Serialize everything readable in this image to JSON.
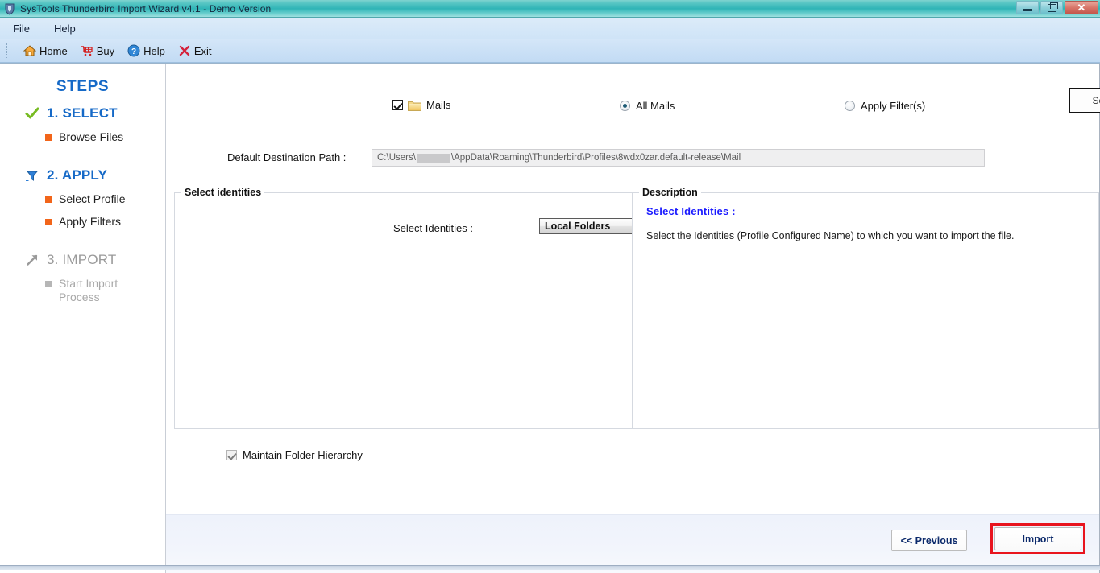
{
  "window": {
    "title": "SysTools Thunderbird Import Wizard v4.1 - Demo Version",
    "icon": "app-shield-icon",
    "controls": {
      "minimize": "minimize-button",
      "restore": "restore-button",
      "close_glyph": "✕"
    }
  },
  "menubar": {
    "items": [
      {
        "label": "File"
      },
      {
        "label": "Help"
      }
    ]
  },
  "toolbar": {
    "items": [
      {
        "label": "Home",
        "icon": "home-icon"
      },
      {
        "label": "Buy",
        "icon": "cart-icon"
      },
      {
        "label": "Help",
        "icon": "help-circle-icon"
      },
      {
        "label": "Exit",
        "icon": "close-x-icon"
      }
    ]
  },
  "sidebar": {
    "title": "STEPS",
    "steps": [
      {
        "label": "1. SELECT",
        "icon": "green-check-icon",
        "state": "done",
        "substeps": [
          {
            "label": "Browse Files",
            "state": "active"
          }
        ]
      },
      {
        "label": "2. APPLY",
        "icon": "funnel-filter-icon",
        "state": "active",
        "substeps": [
          {
            "label": "Select Profile",
            "state": "active"
          },
          {
            "label": "Apply Filters",
            "state": "active"
          }
        ]
      },
      {
        "label": "3. IMPORT",
        "icon": "arrow-up-right-icon",
        "state": "disabled",
        "substeps": [
          {
            "label": "Start Import Process",
            "state": "disabled"
          }
        ]
      }
    ]
  },
  "main": {
    "mails_checkbox": {
      "label": "Mails",
      "checked": true,
      "icon": "folder-icon"
    },
    "scope_radios": [
      {
        "label": "All Mails",
        "selected": true
      },
      {
        "label": "Apply Filter(s)",
        "selected": false
      }
    ],
    "set_button": {
      "label": "Set .."
    },
    "destination": {
      "label": "Default Destination Path :",
      "value_prefix": "C:\\Users\\",
      "value_suffix": "\\AppData\\Roaming\\Thunderbird\\Profiles\\8wdx0zar.default-release\\Mail",
      "redacted": true
    },
    "identities_group": {
      "legend": "Select identities",
      "field_label": "Select Identities :",
      "selected_option": "Local Folders",
      "options": [
        "Local Folders"
      ]
    },
    "description_group": {
      "legend": "Description",
      "title": "Select Identities :",
      "text": "Select the Identities (Profile Configured Name) to  which  you want to import the file."
    },
    "hierarchy_checkbox": {
      "label": "Maintain Folder Hierarchy",
      "checked": true
    }
  },
  "footer": {
    "previous_button": "<< Previous",
    "import_button": "Import",
    "import_highlighted": true
  },
  "colors": {
    "titlebar_teal": "#2fb4b6",
    "accent_blue": "#1569c7",
    "bullet_orange": "#f2651a",
    "check_green": "#77bb22",
    "highlight_red": "#e8141e",
    "desc_blue": "#1a1aff"
  }
}
